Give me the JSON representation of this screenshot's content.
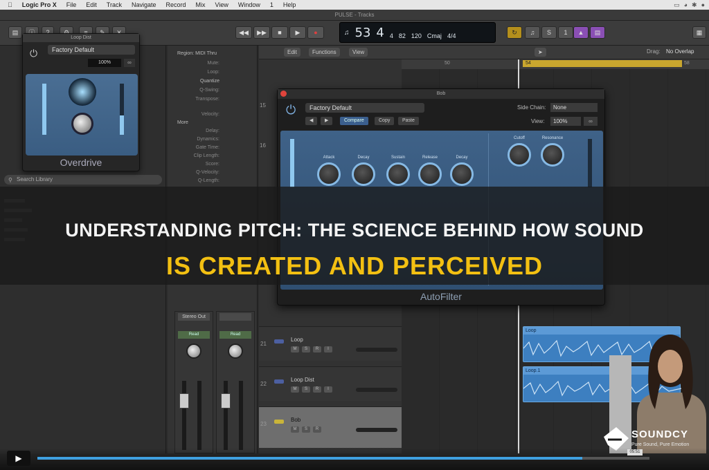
{
  "menubar": {
    "apple_icon": "apple-icon",
    "app": "Logic Pro X",
    "items": [
      "File",
      "Edit",
      "Track",
      "Navigate",
      "Record",
      "Mix",
      "View",
      "Window",
      "1",
      "Help"
    ]
  },
  "window": {
    "title": "PULSE - Tracks"
  },
  "lcd": {
    "bar": "53",
    "beat": "4",
    "div": "4",
    "tick": "82",
    "tempo": "120",
    "key": "Cmaj",
    "sig": "4/4"
  },
  "transport": {
    "rewind": "◀◀",
    "ffwd": "▶▶",
    "stop": "■",
    "play": "▶",
    "record": "●"
  },
  "overdrive": {
    "window_title": "Loop Dist",
    "preset": "Factory Default",
    "percent": "100%",
    "name": "Overdrive"
  },
  "autofilter": {
    "window_title": "Bob",
    "preset": "Factory Default",
    "compare": "Compare",
    "copy": "Copy",
    "paste": "Paste",
    "side_chain_label": "Side Chain:",
    "side_chain_value": "None",
    "view_label": "View:",
    "view_value": "100%",
    "name": "AutoFilter",
    "knobs": [
      "Attack",
      "Decay",
      "Sustain",
      "Release",
      "Decay"
    ],
    "right_knobs": [
      "Cutoff",
      "Resonance"
    ]
  },
  "library": {
    "search_placeholder": "Search Library"
  },
  "inspector": {
    "region_header": "Region: MIDI Thru",
    "rows": [
      "Mute:",
      "Loop:",
      "Quantize",
      "Q-Swing:",
      "Transpose:",
      "Velocity:",
      "More",
      "Delay:",
      "Dynamics:",
      "Gate Time:",
      "Clip Length:",
      "Score:",
      "Q-Velocity:",
      "Q-Length:"
    ]
  },
  "track_toolbar": {
    "edit": "Edit",
    "functions": "Functions",
    "view": "View"
  },
  "drag": {
    "label": "Drag:",
    "value": "No Overlap"
  },
  "ruler": {
    "marks": [
      "50",
      "54",
      "58"
    ]
  },
  "tracks": [
    {
      "num": "21",
      "name": "Loop",
      "selected": false
    },
    {
      "num": "22",
      "name": "Loop Dist",
      "selected": false
    },
    {
      "num": "23",
      "name": "Bob",
      "selected": true
    }
  ],
  "regions": [
    {
      "label": "Loop"
    },
    {
      "label": "Loop.1"
    }
  ],
  "mixer": {
    "strip1": {
      "label": "Stereo Out",
      "slot": "Read"
    },
    "strip2": {
      "label": "",
      "slot": "Read"
    }
  },
  "banner": {
    "line1": "UNDERSTANDING PITCH: THE SCIENCE BEHIND HOW SOUND",
    "line2": "IS CREATED AND PERCEIVED"
  },
  "video": {
    "progress": 0.89,
    "timecode": "05:51"
  },
  "brand": {
    "name": "SOUNDCY",
    "tagline": "Pure Sound, Pure Emotion"
  },
  "colors": {
    "accent": "#f3c012",
    "progress": "#3fa0e0",
    "region": "#3d7fc0"
  }
}
